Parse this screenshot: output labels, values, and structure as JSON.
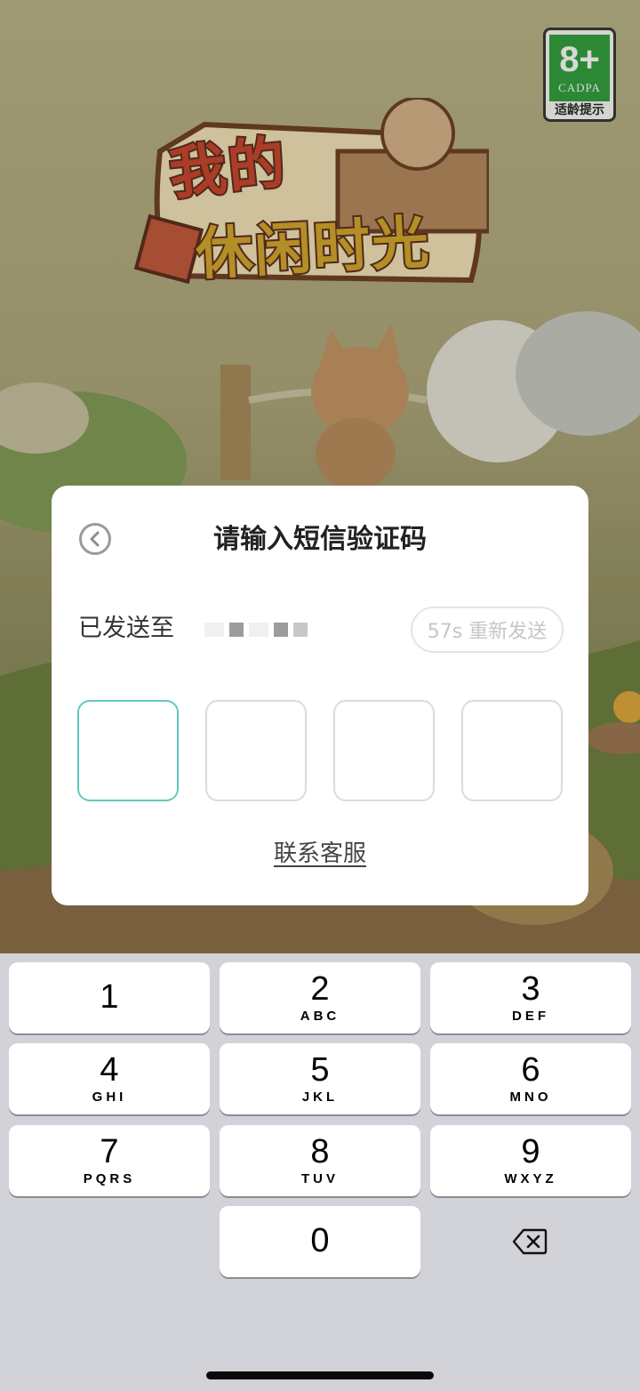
{
  "background": {
    "age_rating": {
      "age": "8+",
      "org": "CADPA",
      "hint": "适龄提示"
    },
    "logo": {
      "line1": "我的",
      "line2": "休闲时光"
    }
  },
  "dialog": {
    "title": "请输入短信验证码",
    "back_icon": "chevron-left-circle-icon",
    "sent_to_label": "已发送至",
    "resend_label": "57s 重新发送",
    "code_length": 4,
    "contact_link": "联系客服"
  },
  "keyboard": {
    "keys": [
      {
        "num": "1",
        "letters": ""
      },
      {
        "num": "2",
        "letters": "ABC"
      },
      {
        "num": "3",
        "letters": "DEF"
      },
      {
        "num": "4",
        "letters": "GHI"
      },
      {
        "num": "5",
        "letters": "JKL"
      },
      {
        "num": "6",
        "letters": "MNO"
      },
      {
        "num": "7",
        "letters": "PQRS"
      },
      {
        "num": "8",
        "letters": "TUV"
      },
      {
        "num": "9",
        "letters": "WXYZ"
      },
      {
        "num": "0",
        "letters": ""
      }
    ],
    "delete_icon": "backspace-icon"
  },
  "colors": {
    "active_code_border": "#62c8bd",
    "resend_text": "#c6c6c6",
    "keyboard_bg": "#d1d3d9"
  }
}
